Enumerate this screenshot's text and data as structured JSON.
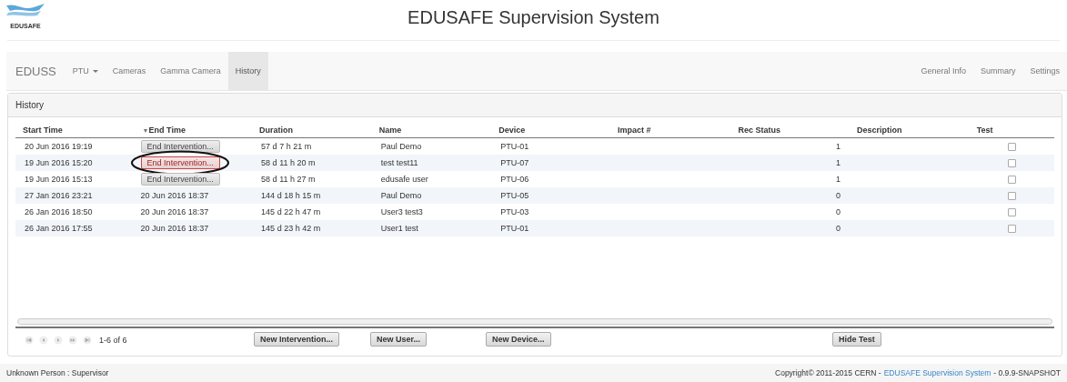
{
  "header": {
    "logo_text": "EDUSAFE",
    "title": "EDUSAFE Supervision System"
  },
  "navbar": {
    "brand": "EDUSS",
    "items": [
      {
        "label": "PTU",
        "dropdown": true,
        "selected": false
      },
      {
        "label": "Cameras",
        "dropdown": false,
        "selected": false
      },
      {
        "label": "Gamma Camera",
        "dropdown": false,
        "selected": false
      },
      {
        "label": "History",
        "dropdown": false,
        "selected": true
      }
    ],
    "right_items": [
      "General Info",
      "Summary",
      "Settings"
    ]
  },
  "panel": {
    "title": "History",
    "table": {
      "columns": [
        {
          "label": "Start Time",
          "sorted": false
        },
        {
          "label": "End Time",
          "sorted": true
        },
        {
          "label": "Duration",
          "sorted": false
        },
        {
          "label": "Name",
          "sorted": false
        },
        {
          "label": "Device",
          "sorted": false
        },
        {
          "label": "Impact #",
          "sorted": false
        },
        {
          "label": "Rec Status",
          "sorted": false
        },
        {
          "label": "Description",
          "sorted": false
        },
        {
          "label": "Test",
          "sorted": false
        }
      ],
      "sort_arrow": "▼",
      "rows": [
        {
          "start": "20 Jun 2016 19:19",
          "end": {
            "kind": "button",
            "text": "End Intervention...",
            "highlighted": false
          },
          "duration": "57 d 7 h 21 m",
          "name": "Paul Demo",
          "device": "PTU-01",
          "rec_status": "1",
          "test": false
        },
        {
          "start": "19 Jun 2016 15:20",
          "end": {
            "kind": "button",
            "text": "End Intervention...",
            "highlighted": true
          },
          "duration": "58 d 11 h 20 m",
          "name": "test test11",
          "device": "PTU-07",
          "rec_status": "1",
          "test": false
        },
        {
          "start": "19 Jun 2016 15:13",
          "end": {
            "kind": "button",
            "text": "End Intervention...",
            "highlighted": false
          },
          "duration": "58 d 11 h 27 m",
          "name": "edusafe user",
          "device": "PTU-06",
          "rec_status": "1",
          "test": false
        },
        {
          "start": "27 Jan 2016 23:21",
          "end": {
            "kind": "text",
            "text": "20 Jun 2016 18:37"
          },
          "duration": "144 d 18 h 15 m",
          "name": "Paul Demo",
          "device": "PTU-05",
          "rec_status": "0",
          "test": false
        },
        {
          "start": "26 Jan 2016 18:50",
          "end": {
            "kind": "text",
            "text": "20 Jun 2016 18:37"
          },
          "duration": "145 d 22 h 47 m",
          "name": "User3 test3",
          "device": "PTU-03",
          "rec_status": "0",
          "test": false
        },
        {
          "start": "26 Jan 2016 17:55",
          "end": {
            "kind": "text",
            "text": "20 Jun 2016 18:37"
          },
          "duration": "145 d 23 h 42 m",
          "name": "User1 test",
          "device": "PTU-01",
          "rec_status": "0",
          "test": false
        }
      ]
    },
    "pager": {
      "range": "1-6 of 6"
    },
    "buttons": [
      "New Intervention...",
      "New User...",
      "New Device...",
      "Hide Test"
    ]
  },
  "status_bar": {
    "user": "Unknown Person : Supervisor",
    "copyright": "Copyright© 2011-2015 CERN - ",
    "link": "EDUSAFE Supervision System",
    "version": " - 0.9.9-SNAPSHOT"
  }
}
